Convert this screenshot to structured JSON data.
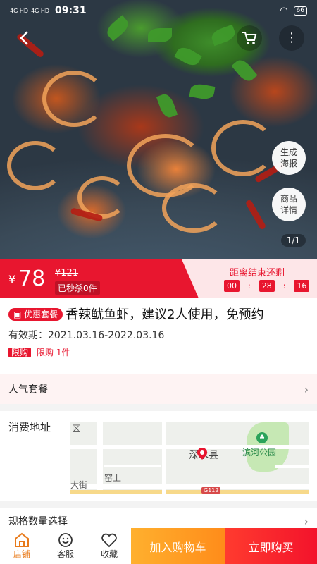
{
  "status_bar": {
    "signal_1": "4G HD",
    "signal_2": "4G HD",
    "time": "09:31",
    "battery": "66"
  },
  "gallery": {
    "pager": "1/1",
    "poster_label": "生成\n海报",
    "detail_label": "商品\n详情"
  },
  "price": {
    "currency": "¥",
    "value": "78",
    "original": "¥121",
    "sold": "已秒杀0件"
  },
  "countdown": {
    "label": "距离结束还剩",
    "hours": "00",
    "minutes": "28",
    "seconds": "16"
  },
  "product": {
    "badge": "优惠套餐",
    "title": "香辣鱿鱼虾，建议2人使用，免预约",
    "validity": "有效期：2021.03.16-2022.03.16",
    "limit_tag": "限购",
    "limit_text": "限购 1件"
  },
  "popular_label": "人气套餐",
  "address": {
    "label": "消费地址",
    "map_labels": {
      "district": "区",
      "county": "深水县",
      "park": "滨河公园",
      "street": "大街",
      "village": "窑上",
      "road_no": "G112"
    }
  },
  "spec_label": "规格数量选择",
  "bottom": {
    "tabs": [
      {
        "label": "店铺",
        "icon": "store-icon"
      },
      {
        "label": "客服",
        "icon": "service-icon"
      },
      {
        "label": "收藏",
        "icon": "heart-icon"
      }
    ],
    "cart_label": "加入购物车",
    "buy_label": "立即购买"
  },
  "colors": {
    "accent_red": "#e8162f",
    "orange": "#ff8c1a",
    "active_tab": "#e87a1a"
  }
}
